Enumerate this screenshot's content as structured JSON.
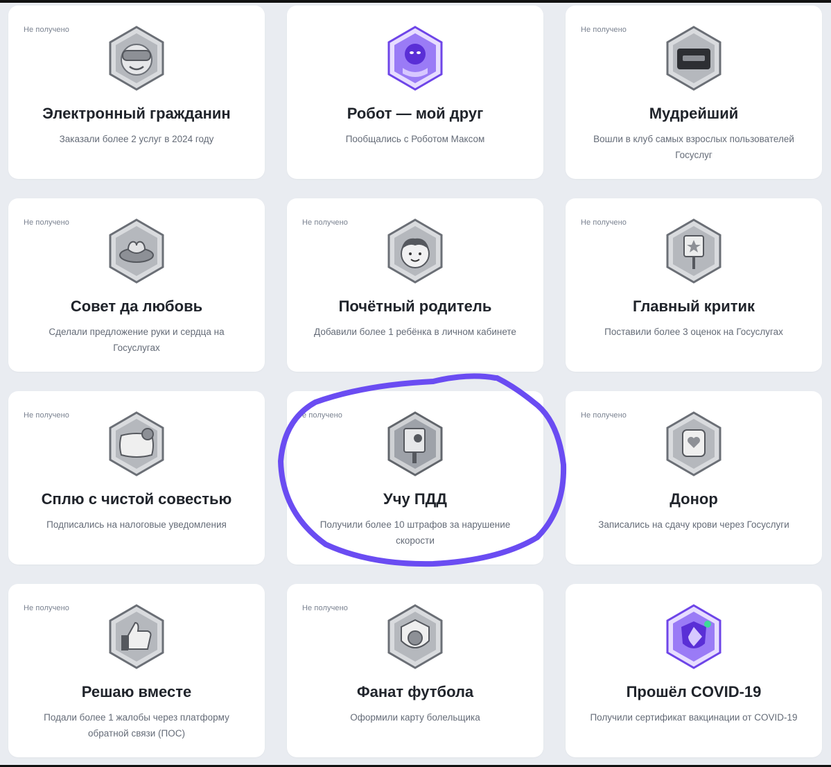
{
  "achievements": [
    {
      "status": "Не получено",
      "title": "Электронный гражданин",
      "description": "Заказали более 2 услуг в 2024 году",
      "icon": "vr-headset-icon",
      "color": "#b9bcc2"
    },
    {
      "status": "",
      "title": "Робот — мой друг",
      "description": "Пообщались с Роботом Максом",
      "icon": "robot-icon",
      "color": "#7f5af0"
    },
    {
      "status": "Не получено",
      "title": "Мудрейший",
      "description": "Вошли в клуб самых взрослых пользователей Госуслуг",
      "icon": "club-card-icon",
      "color": "#b9bcc2"
    },
    {
      "status": "Не получено",
      "title": "Совет да любовь",
      "description": "Сделали предложение руки и сердца на Госуслугах",
      "icon": "rings-icon",
      "color": "#b9bcc2"
    },
    {
      "status": "Не получено",
      "title": "Почётный родитель",
      "description": "Добавили более 1 ребёнка в личном кабинете",
      "icon": "child-face-icon",
      "color": "#b9bcc2"
    },
    {
      "status": "Не получено",
      "title": "Главный критик",
      "description": "Поставили более 3 оценок на Госуслугах",
      "icon": "star-sign-icon",
      "color": "#b9bcc2"
    },
    {
      "status": "Не получено",
      "title": "Сплю с чистой совестью",
      "description": "Подписались на налоговые уведомления",
      "icon": "pillow-icon",
      "color": "#b9bcc2"
    },
    {
      "status": "е получено",
      "title": "Учу ПДД",
      "description": "Получили более 10 штрафов за нарушение скорости",
      "icon": "speed-camera-icon",
      "color": "#9ea2a9"
    },
    {
      "status": "Не получено",
      "title": "Донор",
      "description": "Записались на сдачу крови через Госуслуги",
      "icon": "blood-bag-icon",
      "color": "#b9bcc2"
    },
    {
      "status": "Не получено",
      "title": "Решаю вместе",
      "description": "Подали более 1 жалобы через платформу обратной связи (ПОС)",
      "icon": "thumbs-up-icon",
      "color": "#b9bcc2"
    },
    {
      "status": "Не получено",
      "title": "Фанат футбола",
      "description": "Оформили карту болельщика",
      "icon": "football-shield-icon",
      "color": "#b9bcc2"
    },
    {
      "status": "",
      "title": "Прошёл COVID-19",
      "description": "Получили сертификат вакцинации от COVID-19",
      "icon": "vaccine-shield-icon",
      "color": "#7f5af0"
    }
  ],
  "annotation": {
    "color": "#6a4cf2",
    "shape": "hand-drawn-circle"
  }
}
